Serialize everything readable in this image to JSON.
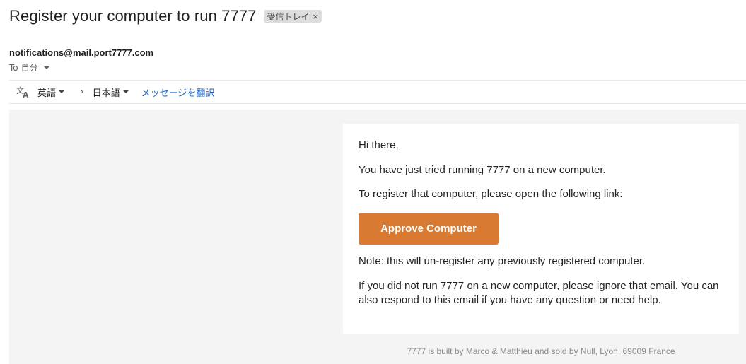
{
  "header": {
    "subject": "Register your computer to run 7777",
    "label": "受信トレイ",
    "label_close": "×"
  },
  "sender": {
    "email": "notifications@mail.port7777.com",
    "to_prefix": "To",
    "to_value": "自分"
  },
  "translate": {
    "source_lang": "英語",
    "target_lang": "日本語",
    "link": "メッセージを翻訳",
    "arrow": "›"
  },
  "email": {
    "greeting": "Hi there,",
    "line1": "You have just tried running 7777 on a new computer.",
    "line2": "To register that computer, please open the following link:",
    "button_label": "Approve Computer",
    "button_color": "#d97a32",
    "note": "Note: this will un-register any previously registered computer.",
    "closing": "If you did not run 7777 on a new computer, please ignore that email. You can also respond to this email if you have any question or need help.",
    "footer": "7777 is built by Marco & Matthieu and sold by Null, Lyon, 69009 France"
  },
  "icons": {
    "translate": "translate-icon",
    "caret": "caret-down-icon",
    "chevron": "chevron-right-icon",
    "close": "close-icon"
  }
}
